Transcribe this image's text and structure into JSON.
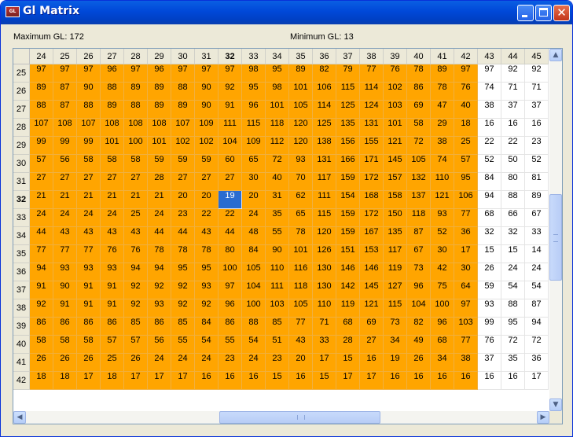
{
  "window": {
    "title": "Gl Matrix",
    "app_icon": "gl-matrix-app-icon",
    "close_glyph": "✕"
  },
  "info": {
    "max_label": "Maximum GL: 172",
    "min_label": "Minimum GL: 13"
  },
  "grid": {
    "columns": [
      "24",
      "25",
      "26",
      "27",
      "28",
      "29",
      "30",
      "31",
      "32",
      "33",
      "34",
      "35",
      "36",
      "37",
      "38",
      "39",
      "40",
      "41",
      "42",
      "43",
      "44",
      "45"
    ],
    "bold_column": "32",
    "bold_row": "32",
    "selected": {
      "row": "32",
      "column": "32"
    },
    "orange_columns_through": "42",
    "colors": {
      "highlight": "#ffa500",
      "selected": "#2a6cd0",
      "header": "#ece9d8"
    },
    "rows": [
      {
        "label": "25",
        "values": [
          "97",
          "97",
          "97",
          "96",
          "97",
          "96",
          "97",
          "97",
          "97",
          "98",
          "95",
          "89",
          "82",
          "79",
          "77",
          "76",
          "78",
          "89",
          "97",
          "97",
          "92",
          "92"
        ]
      },
      {
        "label": "26",
        "values": [
          "89",
          "87",
          "90",
          "88",
          "89",
          "89",
          "88",
          "90",
          "92",
          "95",
          "98",
          "101",
          "106",
          "115",
          "114",
          "102",
          "86",
          "78",
          "76",
          "74",
          "71",
          "71"
        ]
      },
      {
        "label": "27",
        "values": [
          "88",
          "87",
          "88",
          "89",
          "88",
          "89",
          "89",
          "90",
          "91",
          "96",
          "101",
          "105",
          "114",
          "125",
          "124",
          "103",
          "69",
          "47",
          "40",
          "38",
          "37",
          "37"
        ]
      },
      {
        "label": "28",
        "values": [
          "107",
          "108",
          "107",
          "108",
          "108",
          "108",
          "107",
          "109",
          "111",
          "115",
          "118",
          "120",
          "125",
          "135",
          "131",
          "101",
          "58",
          "29",
          "18",
          "16",
          "16",
          "16"
        ]
      },
      {
        "label": "29",
        "values": [
          "99",
          "99",
          "99",
          "101",
          "100",
          "101",
          "102",
          "102",
          "104",
          "109",
          "112",
          "120",
          "138",
          "156",
          "155",
          "121",
          "72",
          "38",
          "25",
          "22",
          "22",
          "23"
        ]
      },
      {
        "label": "30",
        "values": [
          "57",
          "56",
          "58",
          "58",
          "58",
          "59",
          "59",
          "59",
          "60",
          "65",
          "72",
          "93",
          "131",
          "166",
          "171",
          "145",
          "105",
          "74",
          "57",
          "52",
          "50",
          "52"
        ]
      },
      {
        "label": "31",
        "values": [
          "27",
          "27",
          "27",
          "27",
          "27",
          "28",
          "27",
          "27",
          "27",
          "30",
          "40",
          "70",
          "117",
          "159",
          "172",
          "157",
          "132",
          "110",
          "95",
          "84",
          "80",
          "81"
        ]
      },
      {
        "label": "32",
        "values": [
          "21",
          "21",
          "21",
          "21",
          "21",
          "21",
          "20",
          "20",
          "19",
          "20",
          "31",
          "62",
          "111",
          "154",
          "168",
          "158",
          "137",
          "121",
          "106",
          "94",
          "88",
          "89"
        ]
      },
      {
        "label": "33",
        "values": [
          "24",
          "24",
          "24",
          "24",
          "25",
          "24",
          "23",
          "22",
          "22",
          "24",
          "35",
          "65",
          "115",
          "159",
          "172",
          "150",
          "118",
          "93",
          "77",
          "68",
          "66",
          "67"
        ]
      },
      {
        "label": "34",
        "values": [
          "44",
          "43",
          "43",
          "43",
          "43",
          "44",
          "44",
          "43",
          "44",
          "48",
          "55",
          "78",
          "120",
          "159",
          "167",
          "135",
          "87",
          "52",
          "36",
          "32",
          "32",
          "33"
        ]
      },
      {
        "label": "35",
        "values": [
          "77",
          "77",
          "77",
          "76",
          "76",
          "78",
          "78",
          "78",
          "80",
          "84",
          "90",
          "101",
          "126",
          "151",
          "153",
          "117",
          "67",
          "30",
          "17",
          "15",
          "15",
          "14"
        ]
      },
      {
        "label": "36",
        "values": [
          "94",
          "93",
          "93",
          "93",
          "94",
          "94",
          "95",
          "95",
          "100",
          "105",
          "110",
          "116",
          "130",
          "146",
          "146",
          "119",
          "73",
          "42",
          "30",
          "26",
          "24",
          "24"
        ]
      },
      {
        "label": "37",
        "values": [
          "91",
          "90",
          "91",
          "91",
          "92",
          "92",
          "92",
          "93",
          "97",
          "104",
          "111",
          "118",
          "130",
          "142",
          "145",
          "127",
          "96",
          "75",
          "64",
          "59",
          "54",
          "54"
        ]
      },
      {
        "label": "38",
        "values": [
          "92",
          "91",
          "91",
          "91",
          "92",
          "93",
          "92",
          "92",
          "96",
          "100",
          "103",
          "105",
          "110",
          "119",
          "121",
          "115",
          "104",
          "100",
          "97",
          "93",
          "88",
          "87"
        ]
      },
      {
        "label": "39",
        "values": [
          "86",
          "86",
          "86",
          "86",
          "85",
          "86",
          "85",
          "84",
          "86",
          "88",
          "85",
          "77",
          "71",
          "68",
          "69",
          "73",
          "82",
          "96",
          "103",
          "99",
          "95",
          "94"
        ]
      },
      {
        "label": "40",
        "values": [
          "58",
          "58",
          "58",
          "57",
          "57",
          "56",
          "55",
          "54",
          "55",
          "54",
          "51",
          "43",
          "33",
          "28",
          "27",
          "34",
          "49",
          "68",
          "77",
          "76",
          "72",
          "72"
        ]
      },
      {
        "label": "41",
        "values": [
          "26",
          "26",
          "26",
          "25",
          "26",
          "24",
          "24",
          "24",
          "23",
          "24",
          "23",
          "20",
          "17",
          "15",
          "16",
          "19",
          "26",
          "34",
          "38",
          "37",
          "35",
          "36"
        ]
      },
      {
        "label": "42",
        "values": [
          "18",
          "18",
          "17",
          "18",
          "17",
          "17",
          "17",
          "16",
          "16",
          "16",
          "15",
          "16",
          "15",
          "17",
          "17",
          "16",
          "16",
          "16",
          "16",
          "16",
          "16",
          "17"
        ]
      }
    ]
  },
  "scroll": {
    "up": "▲",
    "down": "▼",
    "left": "◀",
    "right": "▶"
  }
}
